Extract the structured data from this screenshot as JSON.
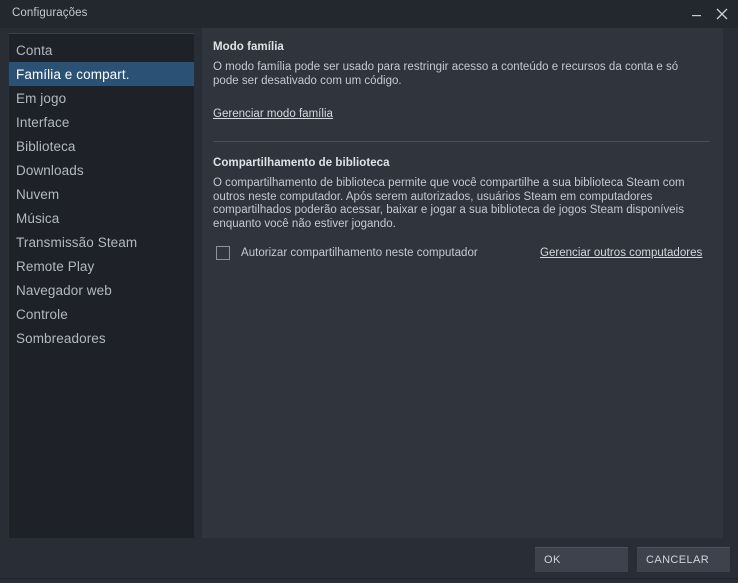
{
  "window": {
    "title": "Configurações",
    "controls": [
      {
        "name": "minimize-button",
        "glyph": "–"
      },
      {
        "name": "close-button",
        "glyph": "✕"
      }
    ]
  },
  "sidebar": {
    "items": [
      {
        "label": "Conta",
        "selected": false
      },
      {
        "label": "Família e compart.",
        "selected": true
      },
      {
        "label": "Em jogo",
        "selected": false
      },
      {
        "label": "Interface",
        "selected": false
      },
      {
        "label": "Biblioteca",
        "selected": false
      },
      {
        "label": "Downloads",
        "selected": false
      },
      {
        "label": "Nuvem",
        "selected": false
      },
      {
        "label": "Música",
        "selected": false
      },
      {
        "label": "Transmissão Steam",
        "selected": false
      },
      {
        "label": "Remote Play",
        "selected": false
      },
      {
        "label": "Navegador web",
        "selected": false
      },
      {
        "label": "Controle",
        "selected": false
      },
      {
        "label": "Sombreadores",
        "selected": false
      }
    ]
  },
  "content": {
    "family_mode": {
      "title": "Modo família",
      "body": "O modo família pode ser usado para restringir acesso a conteúdo e recursos da conta e só pode ser desativado com um código.",
      "link": "Gerenciar modo família"
    },
    "library_sharing": {
      "title": "Compartilhamento de biblioteca",
      "body": "O compartilhamento de biblioteca permite que você compartilhe a sua biblioteca Steam com outros neste computador. Após serem autorizados, usuários Steam em computadores compartilhados poderão acessar, baixar e jogar a sua biblioteca de jogos Steam disponíveis enquanto você não estiver jogando.",
      "checkbox_label": "Autorizar compartilhamento neste computador",
      "checkbox_checked": false,
      "manage_link": "Gerenciar outros computadores"
    }
  },
  "footer": {
    "ok_label": "OK",
    "cancel_label": "CANCELAR"
  },
  "colors": {
    "window_bg": "#292d35",
    "titlebar_bg": "#23272e",
    "sidebar_bg": "#1e2127",
    "content_bg": "#30343c",
    "selection": "#2b5274",
    "text_primary": "#dfe3e6",
    "text_secondary": "#c3cad1",
    "text_sidebar": "#b2b9c0",
    "button_bg": "#3d434c"
  }
}
